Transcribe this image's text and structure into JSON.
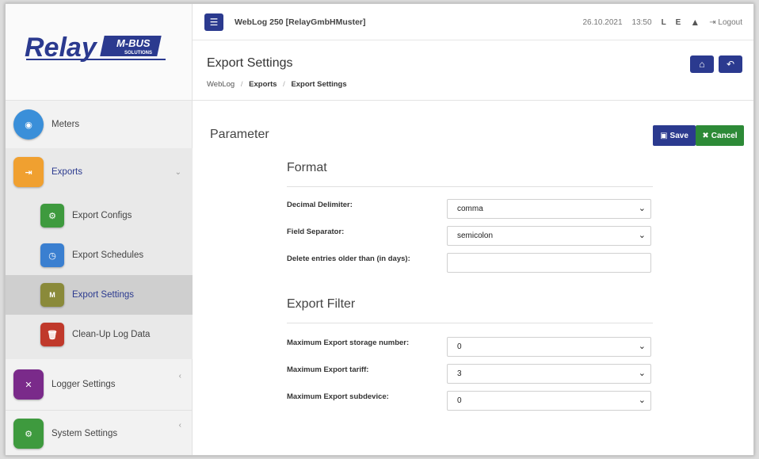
{
  "app": {
    "title": "WebLog 250 [RelayGmbHMuster]",
    "date": "26.10.2021",
    "time": "13:50",
    "flag_l": "L",
    "flag_e": "E",
    "logout": "Logout"
  },
  "logo": {
    "main": "Relay",
    "sub": "M-BUS",
    "sub2": "SOLUTIONS"
  },
  "sidebar": {
    "items": [
      {
        "label": "Meters",
        "icon": "meter-icon",
        "color": "#3a8fd9"
      },
      {
        "label": "Exports",
        "icon": "export-icon",
        "color": "#f0a030"
      },
      {
        "label": "Export Configs",
        "icon": "export-config-icon",
        "color": "#3e9a3e"
      },
      {
        "label": "Export Schedules",
        "icon": "export-schedule-icon",
        "color": "#3a7fd0"
      },
      {
        "label": "Export Settings",
        "icon": "mbus-export-icon",
        "color": "#8a8a3a"
      },
      {
        "label": "Clean-Up Log Data",
        "icon": "cleanup-icon",
        "color": "#c0392b"
      },
      {
        "label": "Logger Settings",
        "icon": "tools-icon",
        "color": "#7a2a8a"
      },
      {
        "label": "System Settings",
        "icon": "gears-icon",
        "color": "#3e9a3e"
      }
    ]
  },
  "header": {
    "title": "Export Settings",
    "breadcrumb": [
      "WebLog",
      "Exports",
      "Export Settings"
    ]
  },
  "content": {
    "title": "Parameter",
    "save_label": "Save",
    "cancel_label": "Cancel",
    "format": {
      "title": "Format",
      "decimal_label": "Decimal Delimiter:",
      "decimal_value": "comma",
      "field_sep_label": "Field Separator:",
      "field_sep_value": "semicolon",
      "delete_label": "Delete entries older than (in days):",
      "delete_value": ""
    },
    "filter": {
      "title": "Export Filter",
      "storage_label": "Maximum Export storage number:",
      "storage_value": "0",
      "tariff_label": "Maximum Export tariff:",
      "tariff_value": "3",
      "subdevice_label": "Maximum Export subdevice:",
      "subdevice_value": "0"
    }
  }
}
